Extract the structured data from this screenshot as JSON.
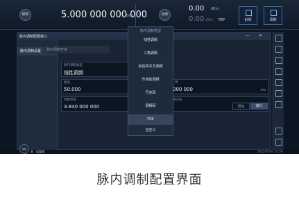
{
  "header": {
    "freq_button": "频率",
    "frequency": "5.000 000 000 000",
    "freq_unit": "GHz",
    "power_button": "功率",
    "power_value": "0.00",
    "power_unit": "dBm",
    "power_value2": "0.00",
    "power_unit2": "dBm",
    "pep": "PEP",
    "rf_label": "射频",
    "mod_label": "调制"
  },
  "window": {
    "title": "脉内调制配置窗口",
    "minimize": "—",
    "close": "✕",
    "nav_item": "脉内调制设置",
    "mod_switch": "脉内调制开关"
  },
  "fields": {
    "type_label": "脉内调制类型",
    "type_value": "线性调频",
    "width_label": "脉宽",
    "width_value": "50.000",
    "bw_label": "调制带宽",
    "bw_value": "3.840 000 000",
    "period_value": "000 000",
    "period_unit": "ms",
    "period_label": "周",
    "dir_label": "频方向",
    "dir_opt_a": "增加",
    "dir_opt_b": "减少"
  },
  "dropdown": {
    "title": "脉内调制类型",
    "items": [
      "线性调频",
      "三角调频",
      "余弦四次方调频",
      "升余弦调频",
      "巴克码",
      "调相码",
      "FSK",
      "自定义"
    ],
    "selected": "FSK"
  },
  "status": {
    "button": "本机",
    "text1": "本",
    "text2": "远程遥",
    "time": "2022-05-07 14:19"
  },
  "caption": "脉内调制配置界面",
  "colors": {
    "background": "#0c1622",
    "accent": "#3f6ea8",
    "selected_item": "#35465e"
  },
  "icons": [
    "frequency-icon",
    "power-icon",
    "rf-icon",
    "modulation-icon",
    "home-icon",
    "copy-icon",
    "save-icon",
    "print-icon",
    "list-icon",
    "camera-icon",
    "back-icon",
    "keyboard-icon",
    "settings-icon"
  ]
}
